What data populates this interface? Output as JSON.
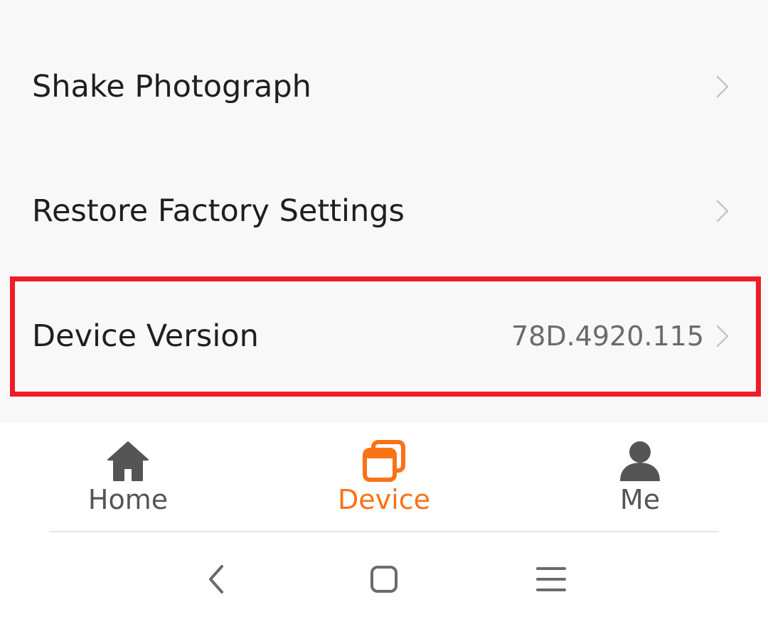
{
  "settings": {
    "rows": [
      {
        "label": "Shake Photograph",
        "value": ""
      },
      {
        "label": "Restore Factory Settings",
        "value": ""
      },
      {
        "label": "Device Version",
        "value": "78D.4920.115"
      }
    ]
  },
  "tabbar": {
    "tabs": [
      {
        "label": "Home",
        "icon": "home-icon",
        "active": false
      },
      {
        "label": "Device",
        "icon": "device-icon",
        "active": true
      },
      {
        "label": "Me",
        "icon": "person-icon",
        "active": false
      }
    ],
    "active_color": "#f97316",
    "inactive_color": "#555555"
  },
  "system_nav": {
    "buttons": [
      "back-icon",
      "home-square-icon",
      "menu-icon"
    ]
  },
  "highlight_color": "#ee1c25"
}
